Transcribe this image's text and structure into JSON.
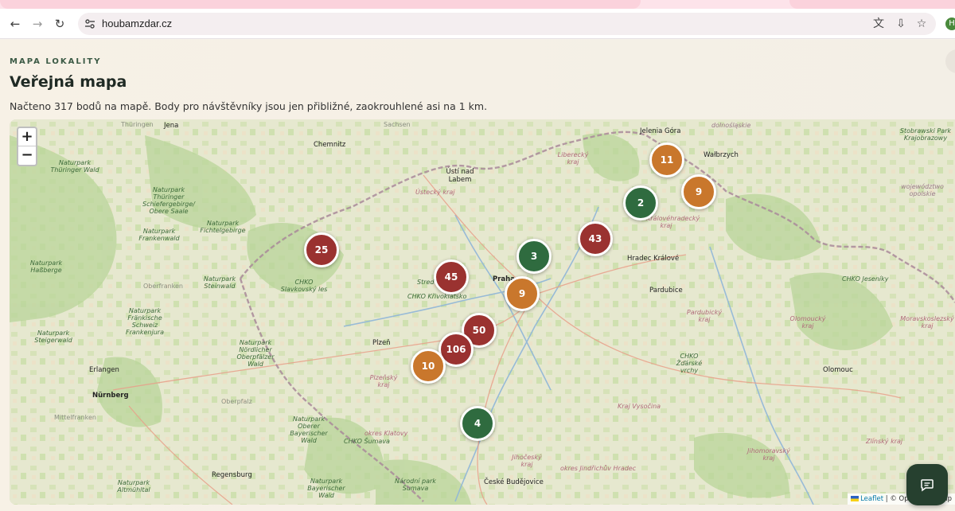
{
  "browser": {
    "url": "houbamzdar.cz",
    "profile_initial": "H",
    "icons": [
      "back-arrow-icon",
      "forward-arrow-icon",
      "reload-icon",
      "site-settings-icon",
      "translate-icon",
      "install-app-icon",
      "bookmark-star-icon"
    ]
  },
  "header": {
    "eyebrow": "MAPA LOKALITY",
    "title": "Veřejná mapa",
    "subtitle": "Načteno 317 bodů na mapě. Body pro návštěvníky jsou jen přibližné, zaokrouhlené asi na 1 km."
  },
  "map": {
    "zoom_in": "+",
    "zoom_out": "−",
    "attribution_leaflet": "Leaflet",
    "attribution_rest": "| © OpenStreetMap",
    "clusters": [
      {
        "count": "25",
        "level": "red"
      },
      {
        "count": "45",
        "level": "red"
      },
      {
        "count": "3",
        "level": "green"
      },
      {
        "count": "9",
        "level": "orange"
      },
      {
        "count": "43",
        "level": "red"
      },
      {
        "count": "2",
        "level": "green"
      },
      {
        "count": "11",
        "level": "orange"
      },
      {
        "count": "9",
        "level": "orange"
      },
      {
        "count": "50",
        "level": "red"
      },
      {
        "count": "106",
        "level": "red"
      },
      {
        "count": "10",
        "level": "orange"
      },
      {
        "count": "4",
        "level": "green"
      }
    ],
    "places": {
      "thuringen": "Thüringen",
      "jena": "Jena",
      "sachsen": "Sachsen",
      "chemnitz": "Chemnitz",
      "jelenia": "Jelenia Góra",
      "dolnoslaskie": "dolnośląskie",
      "walbrzych": "Wałbrzych",
      "stobrawski": "Stobrawski Park Krajobrazowy",
      "np_thuringer": "Naturpark Thüringer Wald",
      "np_schiefer": "Naturpark Thüringer Schiefergebirge/ Obere Saale",
      "usti": "Ústí nad Labem",
      "ustecky": "Ústecký kraj",
      "liberecky": "Liberecký kraj",
      "opolskie": "województwo opolskie",
      "np_frankenwald": "Naturpark Frankenwald",
      "np_fichtel": "Naturpark Fichtelgebirge",
      "hradec": "Hradec Králové",
      "kralovehradecky": "Královéhradecký kraj",
      "chko_slavkov": "CHKO Slavkovský les",
      "stred": "Stred",
      "chko_krivoklat": "CHKO Křivoklátsko",
      "praha": "Praha",
      "chko_jeseniky": "CHKO Jeseníky",
      "np_hassberge": "Naturpark Haßberge",
      "oberfranken": "Oberfranken",
      "np_steinwald": "Naturpark Steinwald",
      "pardubice": "Pardubice",
      "pardubicky": "Pardubický kraj",
      "olomoucky": "Olomoucký kraj",
      "moravskoslezsky": "Moravskoslezský kraj",
      "np_frankische": "Naturpark Fränkische Schweiz Frankenjura",
      "np_steigerwald": "Naturpark Steigerwald",
      "np_nordlicher": "Naturpark Nördlicher Oberpfälzer Wald",
      "plzen": "Plzeň",
      "chko_zdarske": "CHKO Žďárské vrchy",
      "olomouc": "Olomouc",
      "erlangen": "Erlangen",
      "plzensky": "Plzeňský kraj",
      "nurnberg": "Nürnberg",
      "mittelfranken": "Mittelfranken",
      "oberpfalz": "Oberpfalz",
      "np_oberer": "Naturpark Oberer Bayerischer Wald",
      "okres_klatovy": "okres Klatovy",
      "chko_sumava": "CHKO Šumava",
      "kraj_vysocina": "Kraj Vysočina",
      "jihomoravsky": "Jihomoravský kraj",
      "zlinsky": "Zlínský kraj",
      "jihocesky": "Jihočeský kraj",
      "okres_jindrichuv": "okres Jindřichův Hradec",
      "regensburg": "Regensburg",
      "np_altmuhltal": "Naturpark Altmühltal",
      "np_bayerischer": "Naturpark Bayerischer Wald",
      "narodni_sumava": "Národní park Šumava",
      "ceske_budejovice": "České Budějovice"
    }
  },
  "chat": {
    "icon": "chat-icon"
  }
}
